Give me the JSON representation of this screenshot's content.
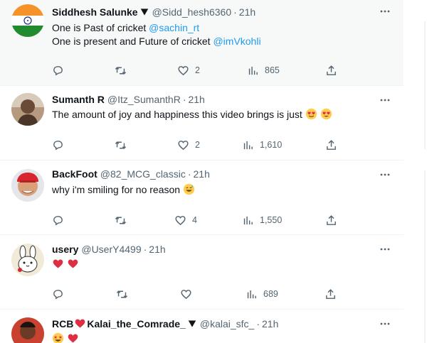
{
  "tweets": [
    {
      "name": "Siddhesh Salunke",
      "handle": "@Sidd_hesh6360",
      "time": "21h",
      "line1_text": "One is Past of cricket ",
      "line1_mention": "@sachin_rt",
      "line2_text": "One is present and  Future of cricket ",
      "line2_mention": "@imVkohli",
      "likes": "2",
      "views": "865"
    },
    {
      "name": "Sumanth R",
      "handle": "@Itz_SumanthR",
      "time": "21h",
      "text": "The amount of joy and happiness this video brings is just",
      "likes": "2",
      "views": "1,610"
    },
    {
      "name": "BackFoot",
      "handle": "@82_MCG_classic",
      "time": "21h",
      "text": "why i'm smiling for no reason",
      "likes": "4",
      "views": "1,550"
    },
    {
      "name": "usery",
      "handle": "@UserY4499",
      "time": "21h",
      "likes": "",
      "views": "689"
    },
    {
      "name_prefix": "RCB",
      "name_suffix": "Kalai_the_Comrade_",
      "handle": "@kalai_sfc_",
      "time": "21h"
    }
  ],
  "colors": {
    "accent": "#1d9bf0",
    "secondary_text": "#536471",
    "heart_red": "#e0245e"
  },
  "icons": [
    "verified-icon",
    "more-icon",
    "reply-icon",
    "retweet-icon",
    "like-icon",
    "views-icon",
    "share-icon"
  ]
}
